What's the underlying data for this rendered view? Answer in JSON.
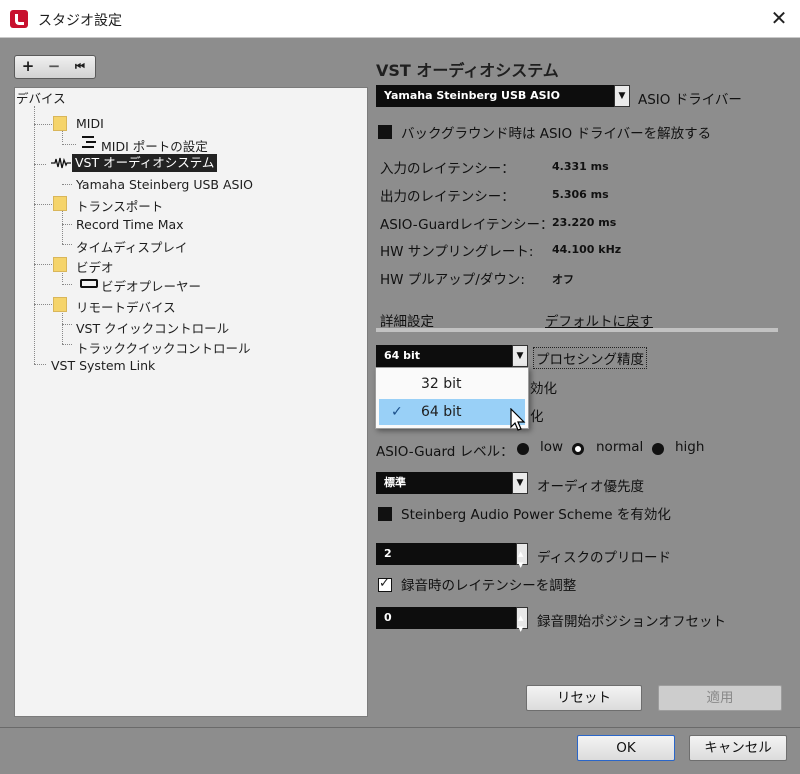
{
  "window": {
    "title": "スタジオ設定",
    "close": "✕"
  },
  "toolbar": {
    "add": "+",
    "remove": "−",
    "reset": "⏮"
  },
  "tree": {
    "header": "デバイス",
    "items": [
      {
        "label": "MIDI"
      },
      {
        "label": "MIDI ポートの設定"
      },
      {
        "label": "VST オーディオシステム"
      },
      {
        "label": "Yamaha Steinberg USB ASIO"
      },
      {
        "label": "トランスポート"
      },
      {
        "label": "Record Time Max"
      },
      {
        "label": "タイムディスプレイ"
      },
      {
        "label": "ビデオ"
      },
      {
        "label": "ビデオプレーヤー"
      },
      {
        "label": "リモートデバイス"
      },
      {
        "label": "VST クイックコントロール"
      },
      {
        "label": "トラッククイックコントロール"
      },
      {
        "label": "VST System Link"
      }
    ]
  },
  "panel": {
    "title": "VST オーディオシステム",
    "driver_value": "Yamaha Steinberg USB ASIO",
    "driver_label": "ASIO ドライバー",
    "release_label": "バックグラウンド時は ASIO ドライバーを解放する",
    "rows": [
      {
        "label": "入力のレイテンシー：",
        "value": "4.331 ms"
      },
      {
        "label": "出力のレイテンシー：",
        "value": "5.306 ms"
      },
      {
        "label": "ASIO-Guardレイテンシー：",
        "value": "23.220 ms"
      },
      {
        "label": "HW サンプリングレート:",
        "value": "44.100 kHz"
      },
      {
        "label": "HW プルアップ/ダウン:",
        "value": "オフ"
      }
    ],
    "advanced": "詳細設定",
    "restore_default": "デフォルトに戻す",
    "precision_value": "64 bit",
    "precision_label": "プロセシング精度",
    "dropdown": [
      "32 bit",
      "64 bit"
    ],
    "hidden1_suffix": "効化",
    "hidden2_suffix": "化",
    "asio_guard_label": "ASIO-Guard レベル：",
    "asio_guard": [
      "low",
      "normal",
      "high"
    ],
    "priority_value": "標準",
    "priority_label": "オーディオ優先度",
    "power_scheme": "Steinberg Audio Power Scheme を有効化",
    "disk_value": "2",
    "disk_label": "ディスクのプリロード",
    "adjust_latency": "録音時のレイテンシーを調整",
    "offset_value": "0",
    "offset_label": "録音開始ポジションオフセット",
    "reset_btn": "リセット",
    "apply_btn": "適用"
  },
  "footer": {
    "ok": "OK",
    "cancel": "キャンセル"
  }
}
